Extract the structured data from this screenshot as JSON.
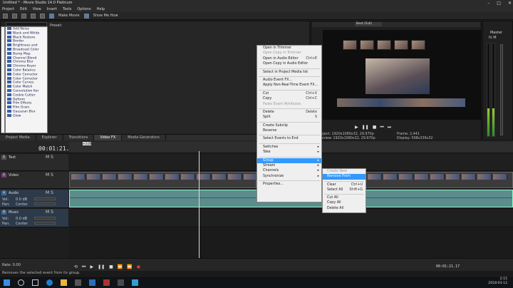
{
  "window": {
    "title": "Untitled * - Movie Studio 14.0 Platinum"
  },
  "menu": [
    "Project",
    "Edit",
    "View",
    "Insert",
    "Tools",
    "Options",
    "Help"
  ],
  "toolbar": {
    "make_movie": "Make Movie",
    "show_me_how": "Show Me How"
  },
  "explorer": {
    "preset_label": "Preset:",
    "fx_list": [
      "Add Noise",
      "Black and White",
      "Black Restore",
      "Border",
      "Brightness and",
      "Broadcast Color",
      "Bump Map",
      "Channel Blend",
      "Chroma Blur",
      "Chroma Keyer",
      "Color Balance",
      "Color Corrector",
      "Color Corrector",
      "Color Curves",
      "Color Match",
      "Convolution Ker",
      "Cookie Cutter",
      "Deform",
      "Film Effects",
      "Film Grain",
      "Gaussian Blur",
      "Glow"
    ],
    "tabs": [
      "Project Media",
      "Explorer",
      "Transitions",
      "Video FX",
      "Media Generators"
    ],
    "active_tab": "Video FX"
  },
  "preview": {
    "quality": "Best (Full)",
    "project_info": "Project: 1920x1080x32, 29.970p",
    "preview_res": "Preview: 1920x1080x32, 29.970p",
    "frame": "Frame:    2,441",
    "display": "Display:   598x336x32"
  },
  "master": {
    "label": "Master",
    "buttons": "fx  M"
  },
  "timeline": {
    "timecode": "00:01:21.17",
    "region_badge": "+3.00",
    "tracks": [
      {
        "num": "1",
        "name": "Text",
        "buttons": "M S"
      },
      {
        "num": "2",
        "name": "Video",
        "buttons": "M S"
      },
      {
        "num": "3",
        "name": "Audio",
        "buttons": "M S",
        "vol_label": "Vol:",
        "vol_value": "0.0 dB",
        "pan_label": "Pan:",
        "pan_value": "Center"
      },
      {
        "num": "4",
        "name": "Music",
        "buttons": "M S",
        "vol_label": "Vol:",
        "vol_value": "0.0 dB",
        "pan_label": "Pan:",
        "pan_value": "Center"
      }
    ]
  },
  "context_menu": {
    "items": [
      {
        "label": "Open in Trimmer",
        "shortcut": "",
        "state": "normal"
      },
      {
        "label": "Open Copy in Trimmer",
        "shortcut": "",
        "state": "disabled"
      },
      {
        "label": "Open in Audio Editor",
        "shortcut": "Ctrl+E",
        "state": "normal"
      },
      {
        "label": "Open Copy in Audio Editor",
        "shortcut": "",
        "state": "normal"
      },
      {
        "label": "",
        "shortcut": "",
        "state": "separator"
      },
      {
        "label": "Select in Project Media list",
        "shortcut": "",
        "state": "normal"
      },
      {
        "label": "",
        "shortcut": "",
        "state": "separator"
      },
      {
        "label": "Audio Event FX...",
        "shortcut": "",
        "state": "normal"
      },
      {
        "label": "Apply Non-Real-Time Event FX...",
        "shortcut": "",
        "state": "normal"
      },
      {
        "label": "",
        "shortcut": "",
        "state": "separator"
      },
      {
        "label": "Cut",
        "shortcut": "Ctrl+X",
        "state": "normal"
      },
      {
        "label": "Copy",
        "shortcut": "Ctrl+C",
        "state": "normal"
      },
      {
        "label": "Paste Event Attributes",
        "shortcut": "",
        "state": "disabled"
      },
      {
        "label": "",
        "shortcut": "",
        "state": "separator"
      },
      {
        "label": "Delete",
        "shortcut": "Delete",
        "state": "normal"
      },
      {
        "label": "Split",
        "shortcut": "S",
        "state": "normal"
      },
      {
        "label": "",
        "shortcut": "",
        "state": "separator"
      },
      {
        "label": "Create Subclip",
        "shortcut": "",
        "state": "normal"
      },
      {
        "label": "Reverse",
        "shortcut": "",
        "state": "normal"
      },
      {
        "label": "",
        "shortcut": "",
        "state": "separator"
      },
      {
        "label": "Select Events to End",
        "shortcut": "",
        "state": "normal"
      },
      {
        "label": "",
        "shortcut": "",
        "state": "separator"
      },
      {
        "label": "Switches",
        "shortcut": "",
        "state": "submenu"
      },
      {
        "label": "Take",
        "shortcut": "",
        "state": "submenu"
      },
      {
        "label": "",
        "shortcut": "",
        "state": "separator"
      },
      {
        "label": "Group",
        "shortcut": "",
        "state": "highlight"
      },
      {
        "label": "Stream",
        "shortcut": "",
        "state": "submenu"
      },
      {
        "label": "Channels",
        "shortcut": "",
        "state": "submenu"
      },
      {
        "label": "Synchronize",
        "shortcut": "",
        "state": "submenu"
      },
      {
        "label": "",
        "shortcut": "",
        "state": "separator"
      },
      {
        "label": "Properties...",
        "shortcut": "",
        "state": "normal"
      }
    ]
  },
  "submenu": {
    "items": [
      {
        "label": "Create New",
        "shortcut": "",
        "state": "disabled"
      },
      {
        "label": "Remove From",
        "shortcut": "",
        "state": "highlight"
      },
      {
        "label": "",
        "shortcut": "",
        "state": "separator"
      },
      {
        "label": "Clear",
        "shortcut": "Ctrl+U",
        "state": "normal"
      },
      {
        "label": "Select All",
        "shortcut": "Shift+G",
        "state": "normal"
      },
      {
        "label": "",
        "shortcut": "",
        "state": "separator"
      },
      {
        "label": "Cut All",
        "shortcut": "",
        "state": "normal"
      },
      {
        "label": "Copy All",
        "shortcut": "",
        "state": "normal"
      },
      {
        "label": "Delete All",
        "shortcut": "",
        "state": "normal"
      }
    ]
  },
  "bottom": {
    "rate": "Rate: 0.00",
    "timecode": "00:01:21.17"
  },
  "status": "Removes the selected event from its group.",
  "clock": {
    "time": "2:15",
    "date": "2018-03-12"
  },
  "colors": {
    "accent": "#3399ff",
    "audio_clip": "#5c8c8c",
    "menu_bg": "#efefef"
  }
}
